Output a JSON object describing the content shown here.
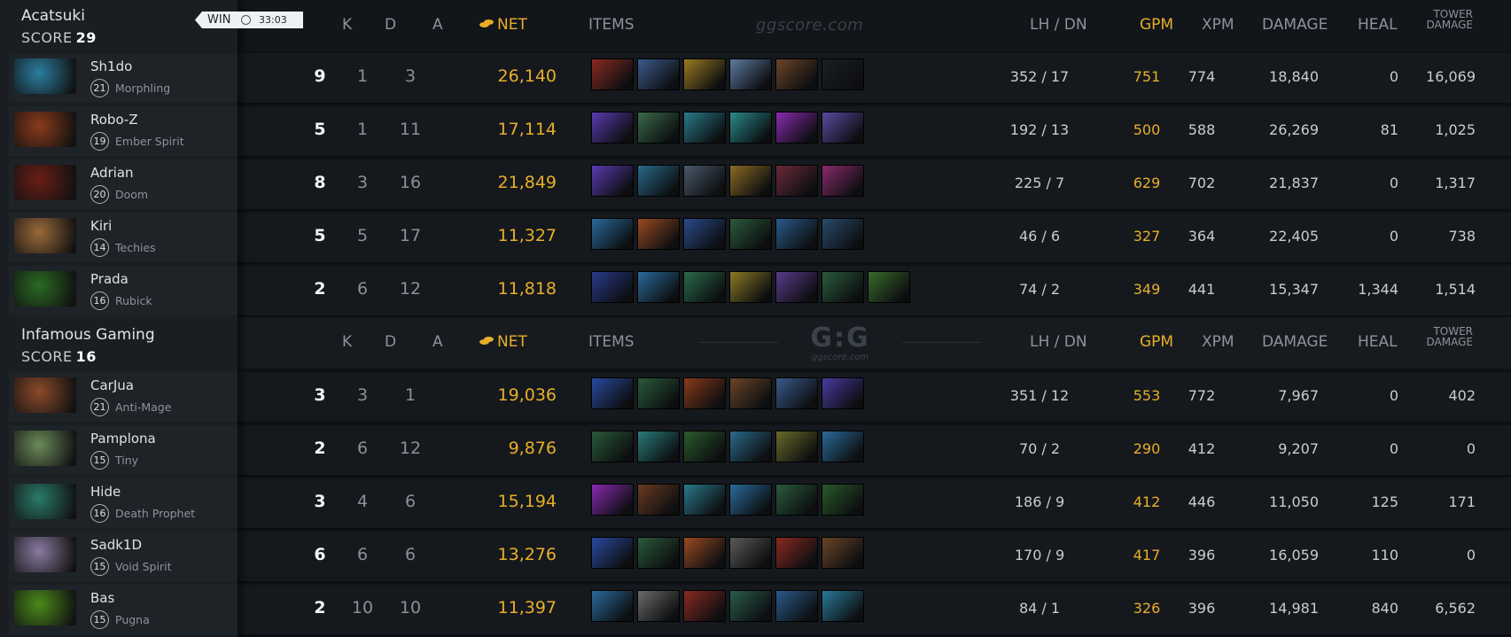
{
  "result": {
    "label": "WIN",
    "duration": "33:03"
  },
  "watermark": {
    "text": "ggscore.com",
    "logo": "G:G",
    "sub": "ggscore.com"
  },
  "headers": {
    "k": "K",
    "d": "D",
    "a": "A",
    "net": "NET",
    "items": "ITEMS",
    "lh_dn": "LH  /  DN",
    "gpm": "GPM",
    "xpm": "XPM",
    "damage": "DAMAGE",
    "heal": "HEAL",
    "tower_line1": "TOWER",
    "tower_line2": "DAMAGE"
  },
  "teams": [
    {
      "name": "Acatsuki",
      "score_label": "SCORE",
      "score": "29",
      "players": [
        {
          "name": "Sh1do",
          "level": "21",
          "hero": "Morphling",
          "k": "9",
          "d": "1",
          "a": "3",
          "net": "26,140",
          "lh_dn": "352  /  17",
          "gpm": "751",
          "xpm": "774",
          "damage": "18,840",
          "heal": "0",
          "tower": "16,069",
          "portrait": "#2a7ea0",
          "items": [
            "#8a2a22",
            "#3c5a8c",
            "#9a7a22",
            "#5c7aa0",
            "#6a4428",
            "#1c1f23"
          ]
        },
        {
          "name": "Robo-Z",
          "level": "19",
          "hero": "Ember Spirit",
          "k": "5",
          "d": "1",
          "a": "11",
          "net": "17,114",
          "lh_dn": "192  /  13",
          "gpm": "500",
          "xpm": "588",
          "damage": "26,269",
          "heal": "81",
          "tower": "1,025",
          "portrait": "#8a3a1a",
          "items": [
            "#5a3ab0",
            "#3a6a4a",
            "#2a7a8a",
            "#2a8a8a",
            "#8a2ab0",
            "#5a4aa0"
          ]
        },
        {
          "name": "Adrian",
          "level": "20",
          "hero": "Doom",
          "k": "8",
          "d": "3",
          "a": "16",
          "net": "21,849",
          "lh_dn": "225  /  7",
          "gpm": "629",
          "xpm": "702",
          "damage": "21,837",
          "heal": "0",
          "tower": "1,317",
          "portrait": "#6a1e16",
          "items": [
            "#5a3ab0",
            "#2a6a8a",
            "#4a5a6a",
            "#8a6a22",
            "#6a2a3a",
            "#8a2a6a"
          ]
        },
        {
          "name": "Kiri",
          "level": "14",
          "hero": "Techies",
          "k": "5",
          "d": "5",
          "a": "17",
          "net": "11,327",
          "lh_dn": "46  /  6",
          "gpm": "327",
          "xpm": "364",
          "damage": "22,405",
          "heal": "0",
          "tower": "738",
          "portrait": "#9a6a3a",
          "items": [
            "#2a6a9a",
            "#9a4a22",
            "#2a4a8a",
            "#2a5a3a",
            "#2a5a8a",
            "#2a4a6a"
          ]
        },
        {
          "name": "Prada",
          "level": "16",
          "hero": "Rubick",
          "k": "2",
          "d": "6",
          "a": "12",
          "net": "11,818",
          "lh_dn": "74  /  2",
          "gpm": "349",
          "xpm": "441",
          "damage": "15,347",
          "heal": "1,344",
          "tower": "1,514",
          "portrait": "#2a6a22",
          "items": [
            "#2a3a8a",
            "#2a6a9a",
            "#2a6a4a",
            "#8a7a22",
            "#5a3a8a",
            "#2a5a3a",
            "#3a6a2a"
          ]
        }
      ]
    },
    {
      "name": "Infamous Gaming",
      "score_label": "SCORE",
      "score": "16",
      "players": [
        {
          "name": "CarJua",
          "level": "21",
          "hero": "Anti-Mage",
          "k": "3",
          "d": "3",
          "a": "1",
          "net": "19,036",
          "lh_dn": "351  /  12",
          "gpm": "553",
          "xpm": "772",
          "damage": "7,967",
          "heal": "0",
          "tower": "402",
          "portrait": "#8a4a2a",
          "items": [
            "#2a4aa0",
            "#2a5a3a",
            "#8a3a1a",
            "#6a4428",
            "#3a5a8a",
            "#4a3aa0"
          ]
        },
        {
          "name": "Pamplona",
          "level": "15",
          "hero": "Tiny",
          "k": "2",
          "d": "6",
          "a": "12",
          "net": "9,876",
          "lh_dn": "70  /  2",
          "gpm": "290",
          "xpm": "412",
          "damage": "9,207",
          "heal": "0",
          "tower": "0",
          "portrait": "#6a8a5a",
          "items": [
            "#2a5a3a",
            "#2a7a7a",
            "#2a5a2a",
            "#2a6a8a",
            "#6a6a2a",
            "#2a6a9a"
          ]
        },
        {
          "name": "Hide",
          "level": "16",
          "hero": "Death Prophet",
          "k": "3",
          "d": "4",
          "a": "6",
          "net": "15,194",
          "lh_dn": "186  /  9",
          "gpm": "412",
          "xpm": "446",
          "damage": "11,050",
          "heal": "125",
          "tower": "171",
          "portrait": "#2a7a6a",
          "items": [
            "#8a2ab0",
            "#6a3a22",
            "#2a7a8a",
            "#2a6a9a",
            "#2a5a3a",
            "#2a5a2a"
          ]
        },
        {
          "name": "Sadk1D",
          "level": "15",
          "hero": "Void Spirit",
          "k": "6",
          "d": "6",
          "a": "6",
          "net": "13,276",
          "lh_dn": "170  /  9",
          "gpm": "417",
          "xpm": "396",
          "damage": "16,059",
          "heal": "110",
          "tower": "0",
          "portrait": "#8a7aa0",
          "items": [
            "#2a4aa0",
            "#2a5a3a",
            "#9a4a22",
            "#5a5a5a",
            "#8a2a22",
            "#6a4428"
          ]
        },
        {
          "name": "Bas",
          "level": "15",
          "hero": "Pugna",
          "k": "2",
          "d": "10",
          "a": "10",
          "net": "11,397",
          "lh_dn": "84  /  1",
          "gpm": "326",
          "xpm": "396",
          "damage": "14,981",
          "heal": "840",
          "tower": "6,562",
          "portrait": "#4a8a1a",
          "items": [
            "#2a6a9a",
            "#6a6a6a",
            "#8a2a22",
            "#2a5a4a",
            "#2a5a8a",
            "#2a7a9a"
          ]
        }
      ]
    }
  ]
}
